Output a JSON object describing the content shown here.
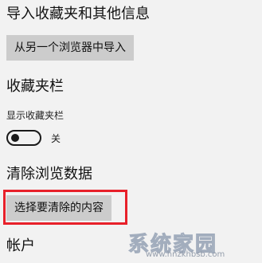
{
  "sections": {
    "import": {
      "title": "导入收藏夹和其他信息",
      "button_label": "从另一个浏览器中导入"
    },
    "favorites_bar": {
      "title": "收藏夹栏",
      "show_label": "显示收藏夹栏",
      "toggle_state": "关",
      "toggle_on": false
    },
    "clear_data": {
      "title": "清除浏览数据",
      "button_label": "选择要清除的内容",
      "highlight_color": "#e8202a"
    },
    "account": {
      "title": "帐户"
    }
  },
  "watermark": {
    "text": "系统家园",
    "subtext": "www.hnzkhbsb.com"
  }
}
